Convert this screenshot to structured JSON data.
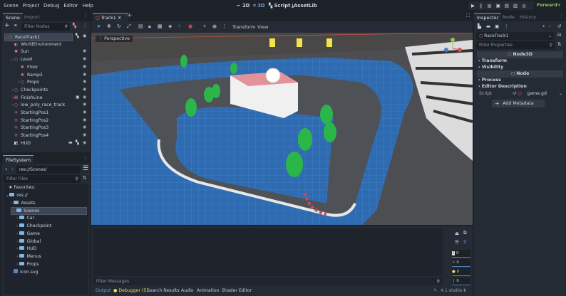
{
  "menu": [
    "Scene",
    "Project",
    "Debug",
    "Editor",
    "Help"
  ],
  "main_screens": {
    "2d": "2D",
    "3d": "3D",
    "script": "Script",
    "assetlib": "AssetLib"
  },
  "renderer": "Forward+",
  "scene_dock": {
    "tabs": [
      "Scene",
      "Import"
    ],
    "filter_placeholder": "Filter Nodes",
    "nodes": [
      {
        "name": "RaceTrack1",
        "icon": "node3d-icon",
        "depth": 0,
        "expanded": true,
        "selected": true,
        "script": true
      },
      {
        "name": "WorldEnvironment",
        "icon": "world-environment-icon",
        "depth": 1
      },
      {
        "name": "Sun",
        "icon": "directional-light-icon",
        "depth": 1,
        "eye": true
      },
      {
        "name": "Level",
        "icon": "node3d-icon",
        "depth": 1,
        "expanded": true,
        "eye": true
      },
      {
        "name": "Floor",
        "icon": "static-body-icon",
        "depth": 2,
        "eye": true
      },
      {
        "name": "Ramp2",
        "icon": "static-body-icon",
        "depth": 2,
        "eye": true
      },
      {
        "name": "Props",
        "icon": "node3d-icon",
        "depth": 2,
        "collapsed": true,
        "eye": true
      },
      {
        "name": "Checkpoints",
        "icon": "node3d-icon",
        "depth": 1,
        "collapsed": true,
        "eye": true
      },
      {
        "name": "FinishLine",
        "icon": "area3d-icon",
        "depth": 1,
        "collapsed": true,
        "eye": true
      },
      {
        "name": "low_poly_race_track",
        "icon": "node3d-icon",
        "depth": 1,
        "collapsed": true,
        "eye": true
      },
      {
        "name": "StartingPos1",
        "icon": "marker3d-icon",
        "depth": 1,
        "eye": true
      },
      {
        "name": "StartingPos2",
        "icon": "marker3d-icon",
        "depth": 1,
        "eye": true
      },
      {
        "name": "StartingPos3",
        "icon": "marker3d-icon",
        "depth": 1,
        "eye": true
      },
      {
        "name": "StartingPos4",
        "icon": "marker3d-icon",
        "depth": 1,
        "eye": true
      },
      {
        "name": "HUD",
        "icon": "control-icon",
        "depth": 1,
        "eye": true
      }
    ]
  },
  "filesystem": {
    "tab": "FileSystem",
    "path": "res://Scenes/",
    "filter_placeholder": "Filter Files",
    "favorites": "Favorites:",
    "root": "res://",
    "items": [
      {
        "name": "Assets",
        "depth": 1
      },
      {
        "name": "Scenes",
        "depth": 1,
        "selected": true
      },
      {
        "name": "Car",
        "depth": 2
      },
      {
        "name": "Checkpoint",
        "depth": 2
      },
      {
        "name": "Game",
        "depth": 2
      },
      {
        "name": "Global",
        "depth": 2
      },
      {
        "name": "HUD",
        "depth": 2
      },
      {
        "name": "Menus",
        "depth": 2
      },
      {
        "name": "Props",
        "depth": 2
      }
    ],
    "file": "icon.svg"
  },
  "editor": {
    "tab": "Track1",
    "viewport_label": "Perspective",
    "toolbar": {
      "transform": "Transform",
      "view": "View"
    }
  },
  "bottom": {
    "filter_placeholder": "Filter Messages",
    "counters": {
      "messages": "0",
      "errors": "0",
      "warnings": "0",
      "info": "0"
    },
    "tabs": [
      "Output",
      "Debugger (5)",
      "Search Results",
      "Audio",
      "Animation",
      "Shader Editor"
    ],
    "version": "4.1.stable"
  },
  "inspector": {
    "tabs": [
      "Inspector",
      "Node",
      "History"
    ],
    "object": "RaceTrack1",
    "filter_placeholder": "Filter Properties",
    "sections": {
      "node3d": "Node3D",
      "node": "Node"
    },
    "groups": {
      "transform": "Transform",
      "visibility": "Visibility",
      "process": "Process",
      "editor_description": "Editor Description"
    },
    "script_label": "Script",
    "script_value": "game.gd",
    "add_metadata": "Add Metadata"
  },
  "colors": {
    "accent": "#6a9bd8",
    "node3d": "#fc7f7f",
    "warning": "#f5d94a",
    "renderer": "#8fc45a"
  }
}
